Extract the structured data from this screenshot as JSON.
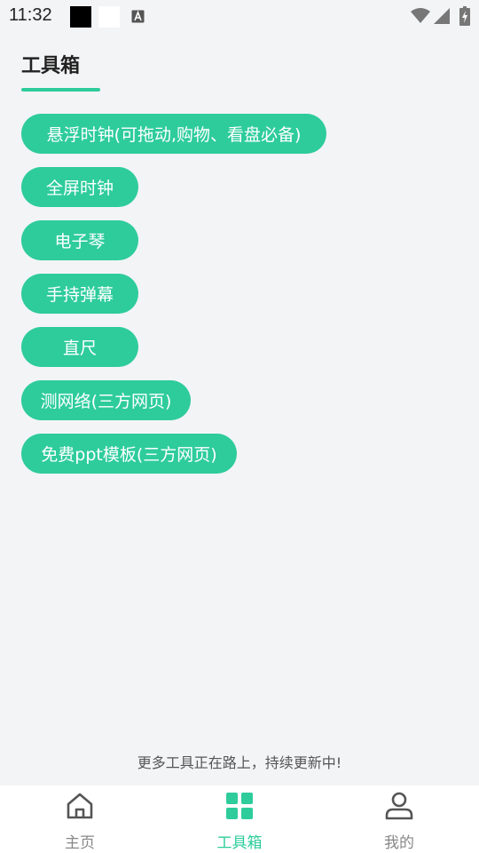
{
  "status_bar": {
    "time": "11:32"
  },
  "header": {
    "title": "工具箱"
  },
  "tools": [
    {
      "label": "悬浮时钟(可拖动,购物、看盘必备)"
    },
    {
      "label": "全屏时钟"
    },
    {
      "label": "电子琴"
    },
    {
      "label": "手持弹幕"
    },
    {
      "label": "直尺"
    },
    {
      "label": "测网络(三方网页)"
    },
    {
      "label": "免费ppt模板(三方网页)"
    }
  ],
  "footer_note": "更多工具正在路上，持续更新中!",
  "bottom_nav": [
    {
      "label": "主页",
      "icon": "home-icon",
      "active": false
    },
    {
      "label": "工具箱",
      "icon": "grid-icon",
      "active": true
    },
    {
      "label": "我的",
      "icon": "person-icon",
      "active": false
    }
  ],
  "colors": {
    "accent": "#2ecc9b",
    "background": "#f3f4f6",
    "inactive": "#888888"
  }
}
